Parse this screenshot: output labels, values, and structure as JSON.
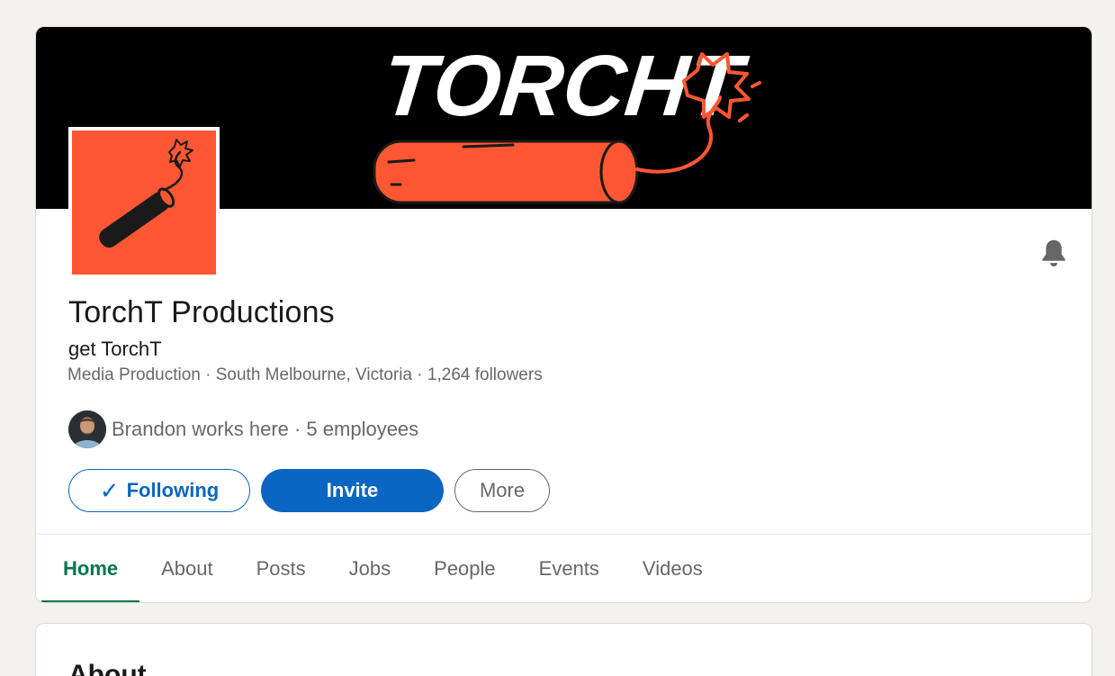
{
  "company": {
    "banner_brand": "TORCHT",
    "name": "TorchT Productions",
    "tagline": "get TorchT",
    "meta": "Media Production · South Melbourne, Victoria · 1,264 followers",
    "employees_text": "Brandon works here · 5 employees"
  },
  "actions": {
    "following_check": "✓",
    "following_label": "Following",
    "invite_label": "Invite",
    "more_label": "More"
  },
  "tabs": [
    {
      "label": "Home",
      "active": true
    },
    {
      "label": "About"
    },
    {
      "label": "Posts"
    },
    {
      "label": "Jobs"
    },
    {
      "label": "People"
    },
    {
      "label": "Events"
    },
    {
      "label": "Videos"
    }
  ],
  "next_section": {
    "title": "About"
  },
  "colors": {
    "brand_orange": "#ff5733",
    "primary_blue": "#0a66c2",
    "active_tab_green": "#01754f",
    "page_bg": "#f3f2ef"
  },
  "icons": {
    "notifications": "bell-icon",
    "following_check": "check-icon"
  }
}
